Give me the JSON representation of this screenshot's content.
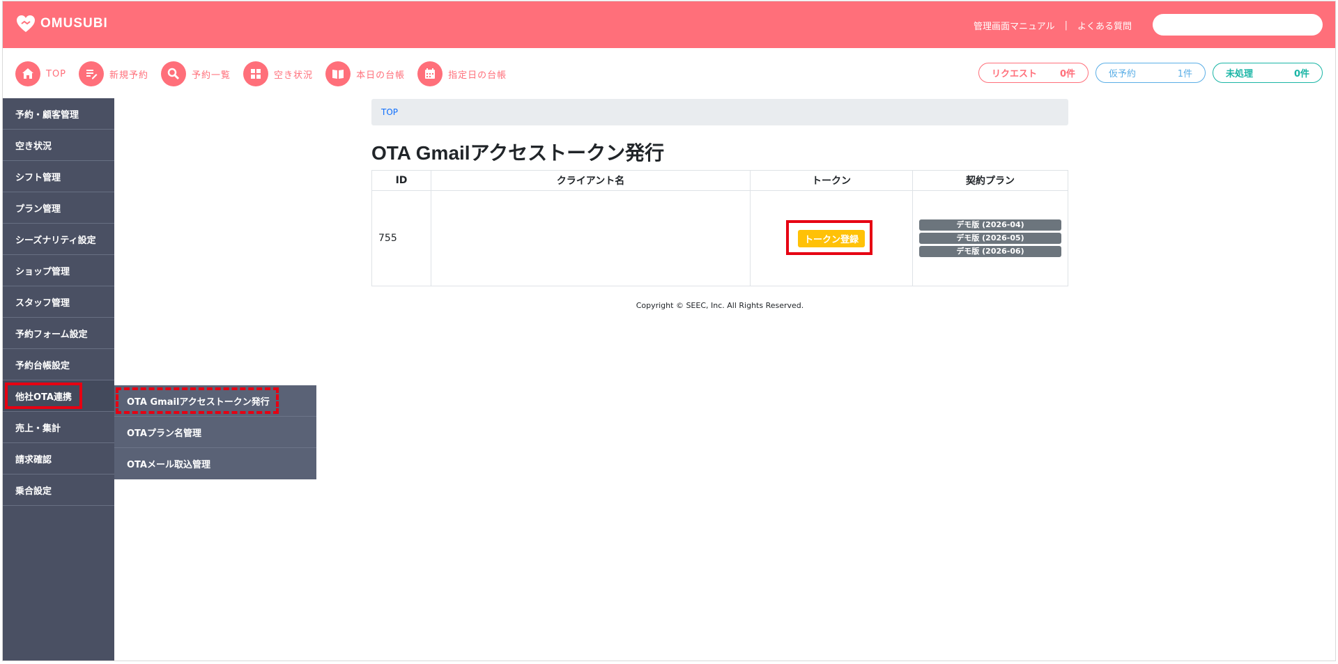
{
  "app": {
    "logo_text": "OMUSUBI"
  },
  "header": {
    "links": [
      "管理画面マニュアル",
      "|",
      "よくある質問"
    ],
    "search": {
      "placeholder": "",
      "value": ""
    }
  },
  "quicknav": [
    {
      "label": "TOP",
      "icon": "home-icon"
    },
    {
      "label": "新規予約",
      "icon": "edit-icon"
    },
    {
      "label": "予約一覧",
      "icon": "search-icon"
    },
    {
      "label": "空き状況",
      "icon": "grid-icon"
    },
    {
      "label": "本日の台帳",
      "icon": "book-icon"
    },
    {
      "label": "指定日の台帳",
      "icon": "calendar-icon"
    }
  ],
  "status": {
    "request": {
      "label": "リクエスト",
      "count": "0件"
    },
    "tentative": {
      "label": "仮予約",
      "count": "1件"
    },
    "unprocessed": {
      "label": "未処理",
      "count": "0件"
    }
  },
  "sidebar": {
    "items": [
      {
        "label": "予約・顧客管理"
      },
      {
        "label": "空き状況"
      },
      {
        "label": "シフト管理"
      },
      {
        "label": "プラン管理"
      },
      {
        "label": "シーズナリティ設定"
      },
      {
        "label": "ショップ管理"
      },
      {
        "label": "スタッフ管理"
      },
      {
        "label": "予約フォーム設定"
      },
      {
        "label": "予約台帳設定"
      },
      {
        "label": "他社OTA連携"
      },
      {
        "label": "売上・集計"
      },
      {
        "label": "請求確認"
      },
      {
        "label": "乗合設定"
      }
    ],
    "active_index": 9
  },
  "submenu": {
    "items": [
      {
        "label": "OTA Gmailアクセストークン発行"
      },
      {
        "label": "OTAプラン名管理"
      },
      {
        "label": "OTAメール取込管理"
      }
    ]
  },
  "breadcrumb": {
    "top": "TOP"
  },
  "page": {
    "title": "OTA Gmailアクセストークン発行"
  },
  "table": {
    "headers": [
      "ID",
      "クライアント名",
      "トークン",
      "契約プラン"
    ],
    "rows": [
      {
        "id": "755",
        "client": "",
        "token_button": "トークン登録",
        "plans": [
          "デモ版 (2026-04)",
          "デモ版 (2026-05)",
          "デモ版 (2026-06)"
        ]
      }
    ]
  },
  "footer": {
    "copyright": "Copyright © SEEC, Inc. All Rights Reserved."
  },
  "colors": {
    "brand": "#ff6f7a",
    "sidebar": "#4a5063",
    "submenu": "#5a6276",
    "warning": "#ffc107",
    "badge": "#6c757d",
    "highlight": "#e60012",
    "info": "#5aaee6",
    "success": "#19b5a5"
  }
}
